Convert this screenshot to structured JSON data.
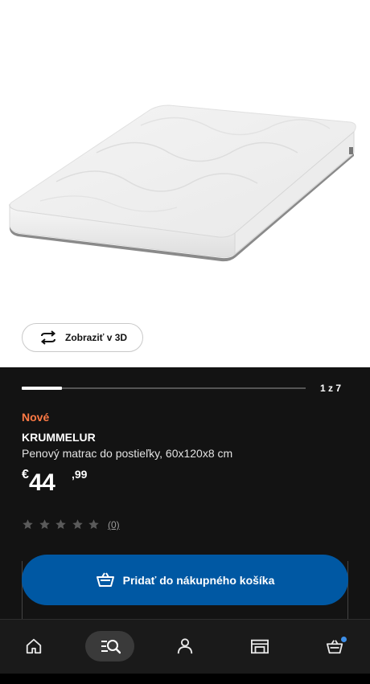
{
  "product_image": {
    "icon": "mattress-image"
  },
  "view3d": {
    "label": "Zobraziť v 3D",
    "icon": "rotate-3d-icon"
  },
  "gallery": {
    "current": 1,
    "total": 7,
    "pager_text": "1 z 7"
  },
  "product": {
    "badge": "Nové",
    "name": "KRUMMELUR",
    "description": "Penový matrac do postieľky, 60x120x8 cm",
    "price": {
      "currency": "€",
      "integer": "44",
      "decimal": ",99"
    },
    "rating": {
      "stars": 0,
      "max": 5,
      "count_text": "(0)"
    }
  },
  "cart_button": {
    "label": "Pridať do nákupného košíka",
    "icon": "basket-icon"
  },
  "tabbar": {
    "items": [
      {
        "name": "home",
        "icon": "home-icon"
      },
      {
        "name": "search",
        "icon": "search-icon",
        "active": true
      },
      {
        "name": "profile",
        "icon": "person-icon"
      },
      {
        "name": "store",
        "icon": "store-icon"
      },
      {
        "name": "cart",
        "icon": "cart-icon",
        "has_dot": true
      }
    ]
  },
  "colors": {
    "accent_blue": "#0058a3",
    "badge_orange": "#ff7a45",
    "panel_bg": "#131313",
    "notification_dot": "#3d8fe8"
  }
}
